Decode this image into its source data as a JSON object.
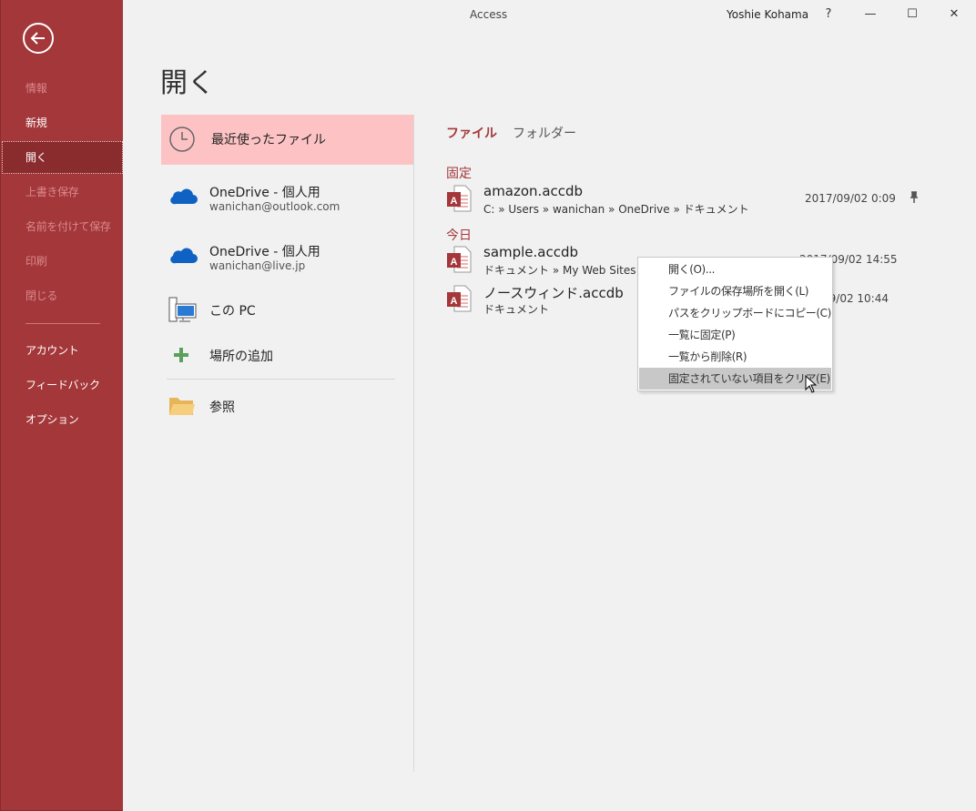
{
  "window": {
    "app_title": "Access",
    "user_name": "Yoshie Kohama",
    "help": "?",
    "minimize": "—",
    "maximize": "☐",
    "close": "✕"
  },
  "sidebar": {
    "items": [
      {
        "label": "情報",
        "state": "disabled"
      },
      {
        "label": "新規",
        "state": "normal"
      },
      {
        "label": "開く",
        "state": "selected"
      },
      {
        "label": "上書き保存",
        "state": "disabled"
      },
      {
        "label": "名前を付けて保存",
        "state": "disabled"
      },
      {
        "label": "印刷",
        "state": "disabled"
      },
      {
        "label": "閉じる",
        "state": "disabled"
      },
      {
        "label": "アカウント",
        "state": "normal"
      },
      {
        "label": "フィードバック",
        "state": "normal"
      },
      {
        "label": "オプション",
        "state": "normal"
      }
    ]
  },
  "page_title": "開く",
  "locations": [
    {
      "label": "最近使ったファイル",
      "sub": "",
      "icon": "clock-icon"
    },
    {
      "label": "OneDrive - 個人用",
      "sub": "wanichan@outlook.com",
      "icon": "onedrive-icon"
    },
    {
      "label": "OneDrive - 個人用",
      "sub": "wanichan@live.jp",
      "icon": "onedrive-icon"
    },
    {
      "label": "この PC",
      "sub": "",
      "icon": "pc-icon"
    },
    {
      "label": "場所の追加",
      "sub": "",
      "icon": "plus-icon"
    },
    {
      "label": "参照",
      "sub": "",
      "icon": "folder-icon"
    }
  ],
  "tabs": {
    "files": "ファイル",
    "folders": "フォルダー"
  },
  "groups": {
    "pinned": "固定",
    "today": "今日"
  },
  "files": [
    {
      "name": "amazon.accdb",
      "path": "C: » Users » wanichan » OneDrive » ドキュメント",
      "date": "2017/09/02 0:09"
    },
    {
      "name": "sample.accdb",
      "path": "ドキュメント » My Web Sites » w",
      "date": "2017/09/02 14:55"
    },
    {
      "name": "ノースウィンド.accdb",
      "path": "ドキュメント",
      "date": "09/02 10:44"
    }
  ],
  "context_menu": {
    "items": [
      "開く(O)...",
      "ファイルの保存場所を開く(L)",
      "パスをクリップボードにコピー(C)",
      "一覧に固定(P)",
      "一覧から削除(R)",
      "固定されていない項目をクリア(E)"
    ]
  },
  "colors": {
    "accent": "#a4373a",
    "selected_location": "#fdc3c4",
    "onedrive": "#0f62c3"
  }
}
